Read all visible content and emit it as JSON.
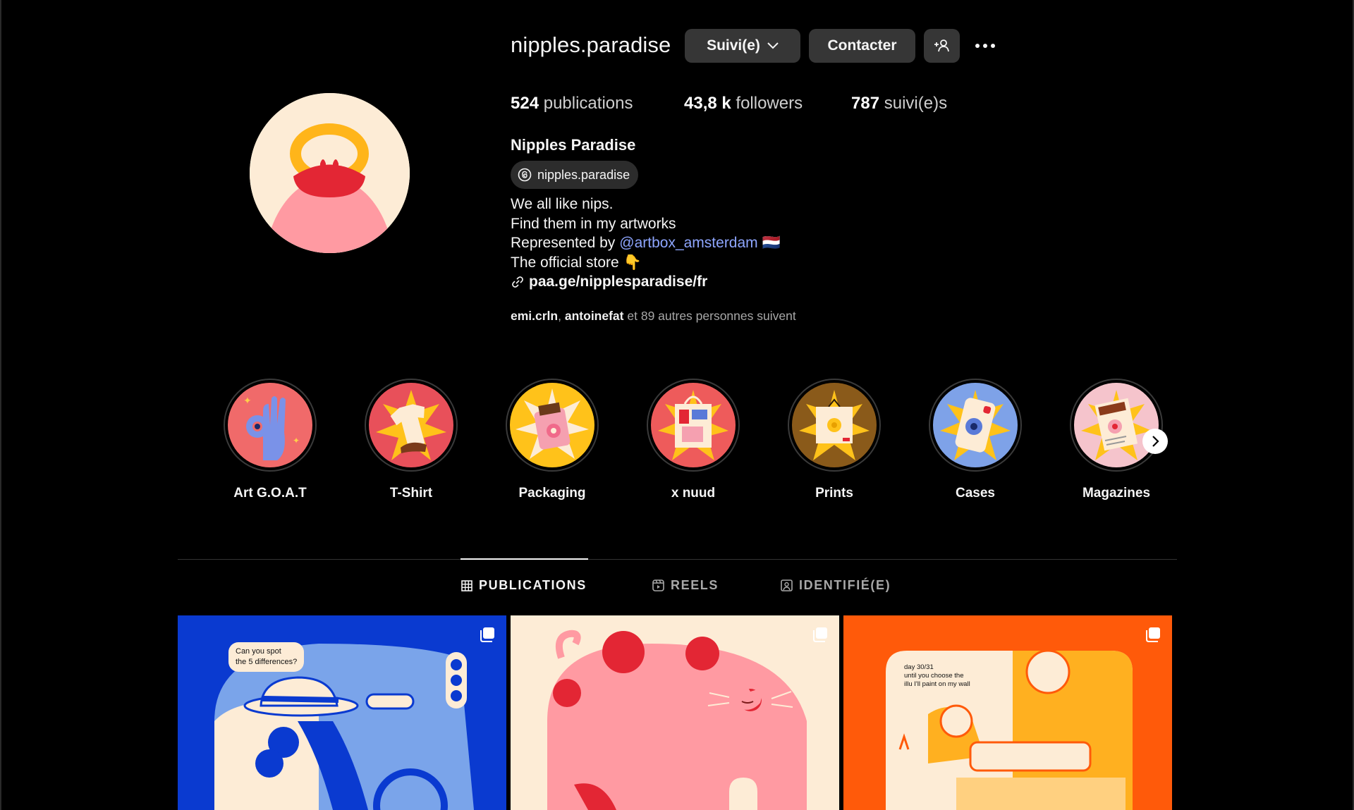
{
  "profile": {
    "username": "nipples.paradise",
    "full_name": "Nipples Paradise",
    "threads_handle": "nipples.paradise"
  },
  "actions": {
    "follow_label": "Suivi(e)",
    "contact_label": "Contacter"
  },
  "stats": {
    "posts_count": "524",
    "posts_label": "publications",
    "followers_count": "43,8 k",
    "followers_label": "followers",
    "following_count": "787",
    "following_label": "suivi(e)s"
  },
  "bio": {
    "line1": "We all like nips.",
    "line2": "Find them in my artworks",
    "line3_prefix": "Represented by",
    "line3_mention": "@artbox_amsterdam",
    "line3_emoji": "🇳🇱",
    "line4_text": "The official store",
    "line4_emoji": "👇",
    "link": "paa.ge/nipplesparadise/fr"
  },
  "followed_by": {
    "user1": "emi.crln",
    "separator": ",",
    "user2": "antoinefat",
    "suffix": "et 89 autres personnes suivent"
  },
  "highlights": [
    {
      "label": "Art G.O.A.T",
      "bg": "#f06a6a"
    },
    {
      "label": "T-Shirt",
      "bg": "#e8505a"
    },
    {
      "label": "Packaging",
      "bg": "#ffc21a"
    },
    {
      "label": "x nuud",
      "bg": "#ee5b5b"
    },
    {
      "label": "Prints",
      "bg": "#8a5a1a"
    },
    {
      "label": "Cases",
      "bg": "#7ea2e8"
    },
    {
      "label": "Magazines",
      "bg": "#f5c4cc"
    }
  ],
  "tabs": {
    "publications": "PUBLICATIONS",
    "reels": "REELS",
    "tagged": "IDENTIFIÉ(E)"
  },
  "posts": [
    {
      "bubble_line1": "Can you spot",
      "bubble_line2": "the 5 differences?"
    },
    {},
    {
      "bubble_line1": "day 30/31",
      "bubble_line2": "until you choose the",
      "bubble_line3": "illu I'll paint on my wall"
    }
  ],
  "colors": {
    "background": "#000000",
    "button_bg": "#363636",
    "mention": "#8ea6ff",
    "muted_text": "#a8a8a8"
  }
}
